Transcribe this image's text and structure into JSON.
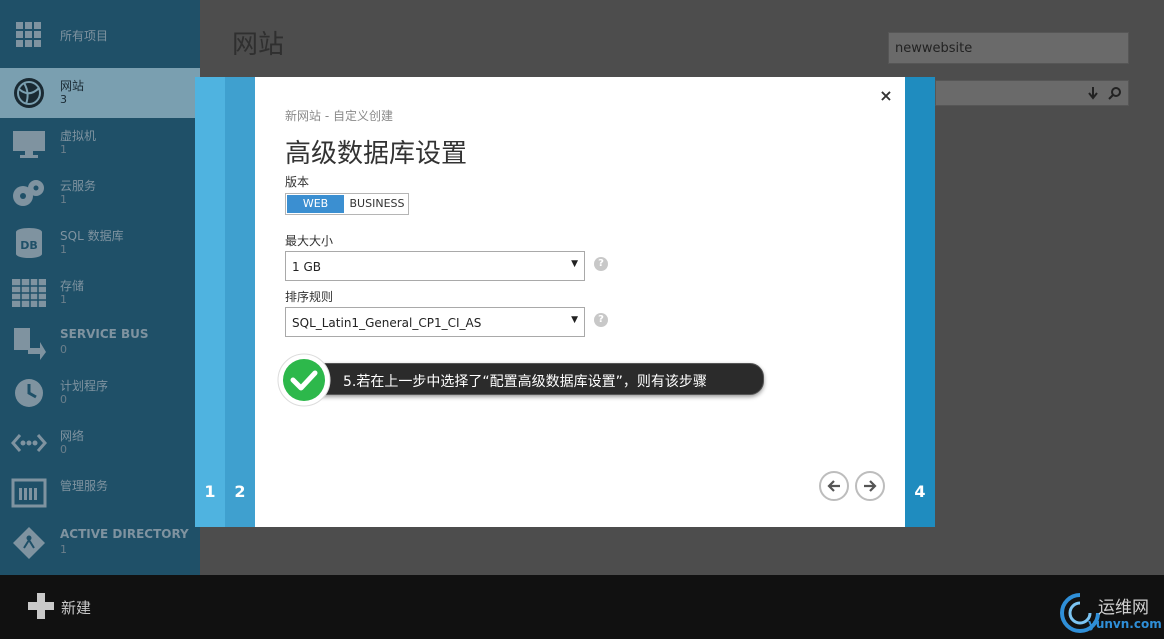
{
  "sidebar": {
    "items": [
      {
        "label": "所有项目",
        "count": "",
        "icon": "grid-icon"
      },
      {
        "label": "网站",
        "count": "3",
        "icon": "globe-icon"
      },
      {
        "label": "虚拟机",
        "count": "1",
        "icon": "monitor-icon"
      },
      {
        "label": "云服务",
        "count": "1",
        "icon": "gears-icon"
      },
      {
        "label": "SQL 数据库",
        "count": "1",
        "icon": "database-icon"
      },
      {
        "label": "存储",
        "count": "1",
        "icon": "table-icon"
      },
      {
        "label": "SERVICE BUS",
        "count": "0",
        "icon": "service-bus-icon"
      },
      {
        "label": "计划程序",
        "count": "0",
        "icon": "clock-icon"
      },
      {
        "label": "网络",
        "count": "0",
        "icon": "network-icon"
      },
      {
        "label": "管理服务",
        "count": "",
        "icon": "management-icon"
      },
      {
        "label": "ACTIVE DIRECTORY",
        "count": "1",
        "icon": "directory-icon"
      }
    ]
  },
  "main": {
    "title": "网站",
    "search_value": "newwebsite"
  },
  "bottom": {
    "new_label": "新建",
    "logo_text": "运维网",
    "logo_sub": "yunvn.com"
  },
  "wizard": {
    "steps": [
      "1",
      "2",
      "4"
    ],
    "subtitle": "新网站 - 自定义创建",
    "title": "高级数据库设置",
    "close": "×",
    "edition_label": "版本",
    "edition_options": [
      "WEB",
      "BUSINESS"
    ],
    "max_size_label": "最大大小",
    "max_size_value": "1 GB",
    "collation_label": "排序规则",
    "collation_value": "SQL_Latin1_General_CP1_CI_AS"
  },
  "callout": {
    "text": "5.若在上一步中选择了“配置高级数据库设置”，则有该步骤"
  },
  "colors": {
    "sidebar_bg": "#1f5068",
    "accent": "#3b8fd1",
    "step1": "#4fb3e0",
    "step2": "#3fa0cf",
    "step4": "#1f8cbf",
    "check_green": "#2db84b"
  }
}
